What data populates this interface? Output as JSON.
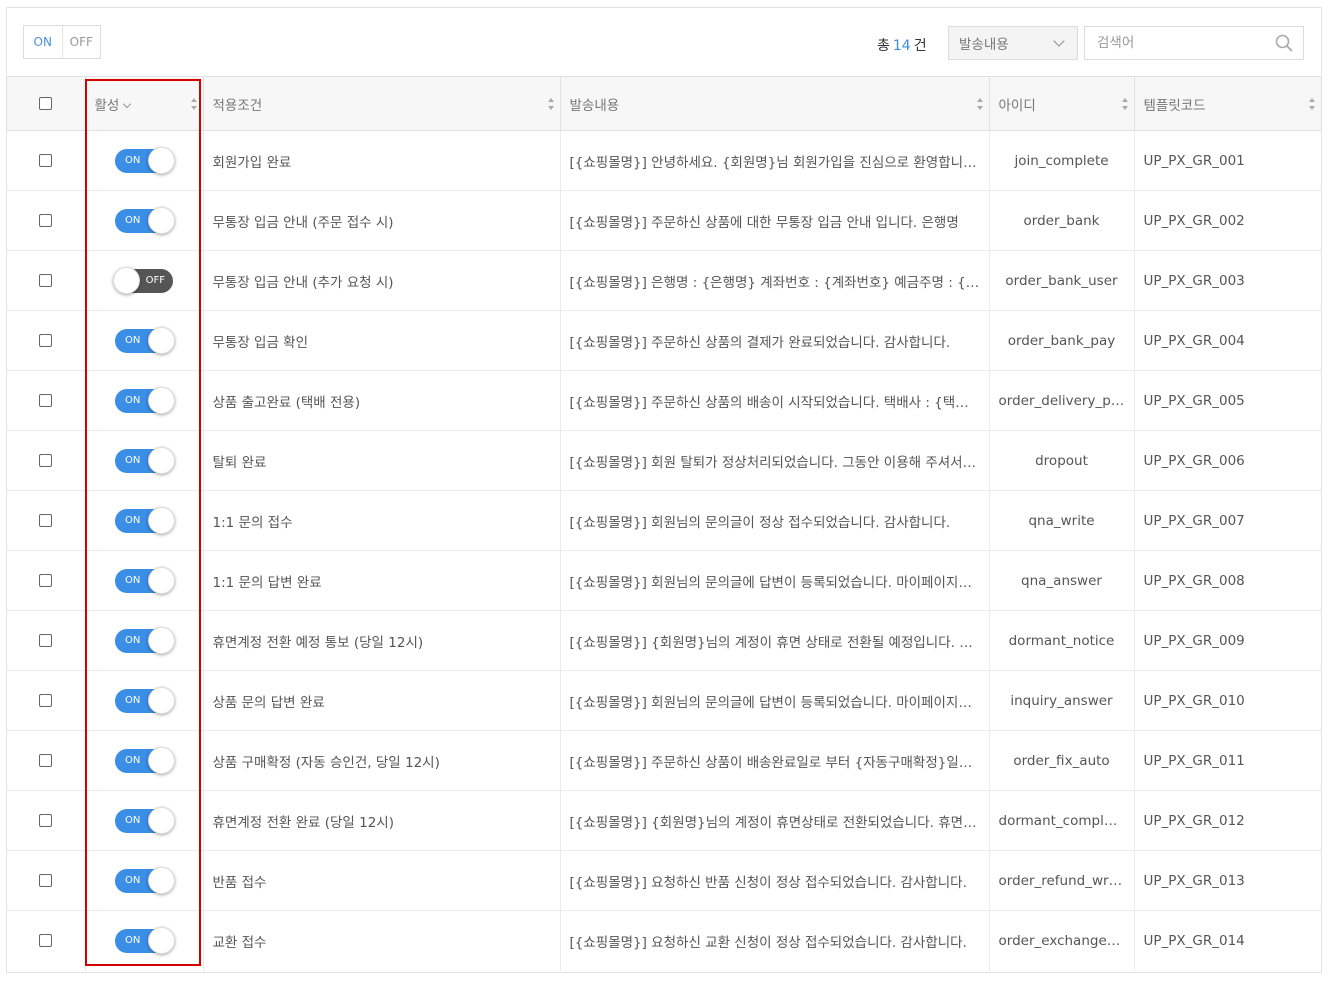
{
  "filter": {
    "on_label": "ON",
    "off_label": "OFF"
  },
  "summary": {
    "prefix": "총",
    "count": "14",
    "suffix": "건"
  },
  "search_type": {
    "selected": "발송내용"
  },
  "search": {
    "placeholder": "검색어"
  },
  "table": {
    "headers": {
      "active": "활성",
      "condition": "적용조건",
      "content": "발송내용",
      "id": "아이디",
      "template": "템플릿코드"
    },
    "rows": [
      {
        "active": true,
        "condition": "회원가입 완료",
        "content": "[{쇼핑몰명}] 안녕하세요. {회원명}님 회원가입을 진심으로 환영합니다.",
        "id": "join_complete",
        "template": "UP_PX_GR_001"
      },
      {
        "active": true,
        "condition": "무통장 입금 안내 (주문 접수 시)",
        "content": "[{쇼핑몰명}] 주문하신 상품에 대한 무통장 입금 안내 입니다. 은행명",
        "id": "order_bank",
        "template": "UP_PX_GR_002"
      },
      {
        "active": false,
        "condition": "무통장 입금 안내 (추가 요청 시)",
        "content": "[{쇼핑몰명}] 은행명 : {은행명} 계좌번호 : {계좌번호} 예금주명 : {예금주명}",
        "id": "order_bank_user",
        "template": "UP_PX_GR_003"
      },
      {
        "active": true,
        "condition": "무통장 입금 확인",
        "content": "[{쇼핑몰명}] 주문하신 상품의 결제가 완료되었습니다. 감사합니다.",
        "id": "order_bank_pay",
        "template": "UP_PX_GR_004"
      },
      {
        "active": true,
        "condition": "상품 출고완료 (택배 전용)",
        "content": "[{쇼핑몰명}] 주문하신 상품의 배송이 시작되었습니다. 택배사 : {택배사명}",
        "id": "order_delivery_pickup",
        "template": "UP_PX_GR_005"
      },
      {
        "active": true,
        "condition": "탈퇴 완료",
        "content": "[{쇼핑몰명}] 회원 탈퇴가 정상처리되었습니다. 그동안 이용해 주셔서 감사합니다.",
        "id": "dropout",
        "template": "UP_PX_GR_006"
      },
      {
        "active": true,
        "condition": "1:1 문의 접수",
        "content": "[{쇼핑몰명}] 회원님의 문의글이 정상 접수되었습니다. 감사합니다.",
        "id": "qna_write",
        "template": "UP_PX_GR_007"
      },
      {
        "active": true,
        "condition": "1:1 문의 답변 완료",
        "content": "[{쇼핑몰명}] 회원님의 문의글에 답변이 등록되었습니다. 마이페이지에서 확인하세요.",
        "id": "qna_answer",
        "template": "UP_PX_GR_008"
      },
      {
        "active": true,
        "condition": "휴면계정 전환 예정 통보 (당일 12시)",
        "content": "[{쇼핑몰명}] {회원명}님의 계정이 휴면 상태로 전환될 예정입니다. 로그인해 주세요.",
        "id": "dormant_notice",
        "template": "UP_PX_GR_009"
      },
      {
        "active": true,
        "condition": "상품 문의 답변 완료",
        "content": "[{쇼핑몰명}] 회원님의 문의글에 답변이 등록되었습니다. 마이페이지에서 확인하세요.",
        "id": "inquiry_answer",
        "template": "UP_PX_GR_010"
      },
      {
        "active": true,
        "condition": "상품 구매확정 (자동 승인건, 당일 12시)",
        "content": "[{쇼핑몰명}] 주문하신 상품이 배송완료일로 부터 {자동구매확정}일이 지나",
        "id": "order_fix_auto",
        "template": "UP_PX_GR_011"
      },
      {
        "active": true,
        "condition": "휴면계정 전환 완료 (당일 12시)",
        "content": "[{쇼핑몰명}] {회원명}님의 계정이 휴면상태로 전환되었습니다. 휴면 해제는",
        "id": "dormant_complete",
        "template": "UP_PX_GR_012"
      },
      {
        "active": true,
        "condition": "반품 접수",
        "content": "[{쇼핑몰명}] 요청하신 반품 신청이 정상 접수되었습니다. 감사합니다.",
        "id": "order_refund_write",
        "template": "UP_PX_GR_013"
      },
      {
        "active": true,
        "condition": "교환 접수",
        "content": "[{쇼핑몰명}] 요청하신 교환 신청이 정상 접수되었습니다. 감사합니다.",
        "id": "order_exchange_write",
        "template": "UP_PX_GR_014"
      }
    ]
  },
  "toggle_labels": {
    "on": "ON",
    "off": "OFF"
  },
  "colors": {
    "accent": "#3a8ee6",
    "toggle_off": "#555555",
    "highlight": "#d40000"
  }
}
